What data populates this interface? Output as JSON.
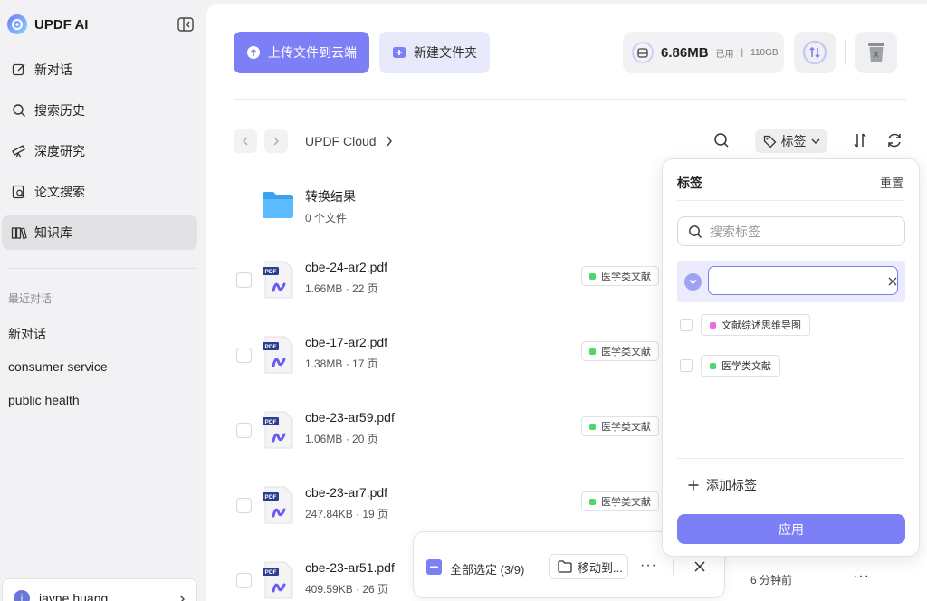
{
  "app": {
    "name": "UPDF AI"
  },
  "sidebar": {
    "items": [
      {
        "label": "新对话",
        "icon": "edit-icon"
      },
      {
        "label": "搜索历史",
        "icon": "search-icon"
      },
      {
        "label": "深度研究",
        "icon": "telescope-icon"
      },
      {
        "label": "论文搜索",
        "icon": "paper-search-icon"
      },
      {
        "label": "知识库",
        "icon": "library-icon",
        "active": true
      }
    ],
    "recent_title": "最近对话",
    "recent": [
      "新对话",
      "consumer service",
      "public health"
    ],
    "user": {
      "initial": "j",
      "name": "jayne huang"
    }
  },
  "toolbar": {
    "upload_label": "上传文件到云端",
    "new_folder_label": "新建文件夹",
    "storage_used": "6.86MB",
    "storage_used_label": "已用",
    "storage_total": "110GB"
  },
  "breadcrumb": {
    "root": "UPDF Cloud"
  },
  "filter": {
    "tag_label": "标签"
  },
  "files": [
    {
      "type": "folder",
      "name": "转换结果",
      "meta": "0 个文件"
    },
    {
      "type": "pdf",
      "name": "cbe-24-ar2.pdf",
      "meta": "1.66MB · 22 页",
      "tag": "医学类文献"
    },
    {
      "type": "pdf",
      "name": "cbe-17-ar2.pdf",
      "meta": "1.38MB · 17 页",
      "tag": "医学类文献"
    },
    {
      "type": "pdf",
      "name": "cbe-23-ar59.pdf",
      "meta": "1.06MB · 20 页",
      "tag": "医学类文献"
    },
    {
      "type": "pdf",
      "name": "cbe-23-ar7.pdf",
      "meta": "247.84KB · 19 页",
      "tag": "医学类文献"
    },
    {
      "type": "pdf",
      "name": "cbe-23-ar51.pdf",
      "meta": "409.59KB · 26 页",
      "time": "6 分钟前"
    }
  ],
  "selection_bar": {
    "select_all_label": "全部选定 (3/9)",
    "move_label": "移动到...",
    "more": "···"
  },
  "tag_panel": {
    "title": "标签",
    "reset_label": "重置",
    "search_placeholder": "搜索标签",
    "new_tag_value": "",
    "tags": [
      {
        "label": "文献综述思维导图",
        "color": "#e86fe0"
      },
      {
        "label": "医学类文献",
        "color": "#4fd66a"
      }
    ],
    "add_label": "添加标签",
    "apply_label": "应用"
  },
  "colors": {
    "accent": "#7c7ff6",
    "accent_light": "#e9e9fc",
    "medical_tag": "#4fd66a",
    "mindmap_tag": "#e86fe0"
  }
}
